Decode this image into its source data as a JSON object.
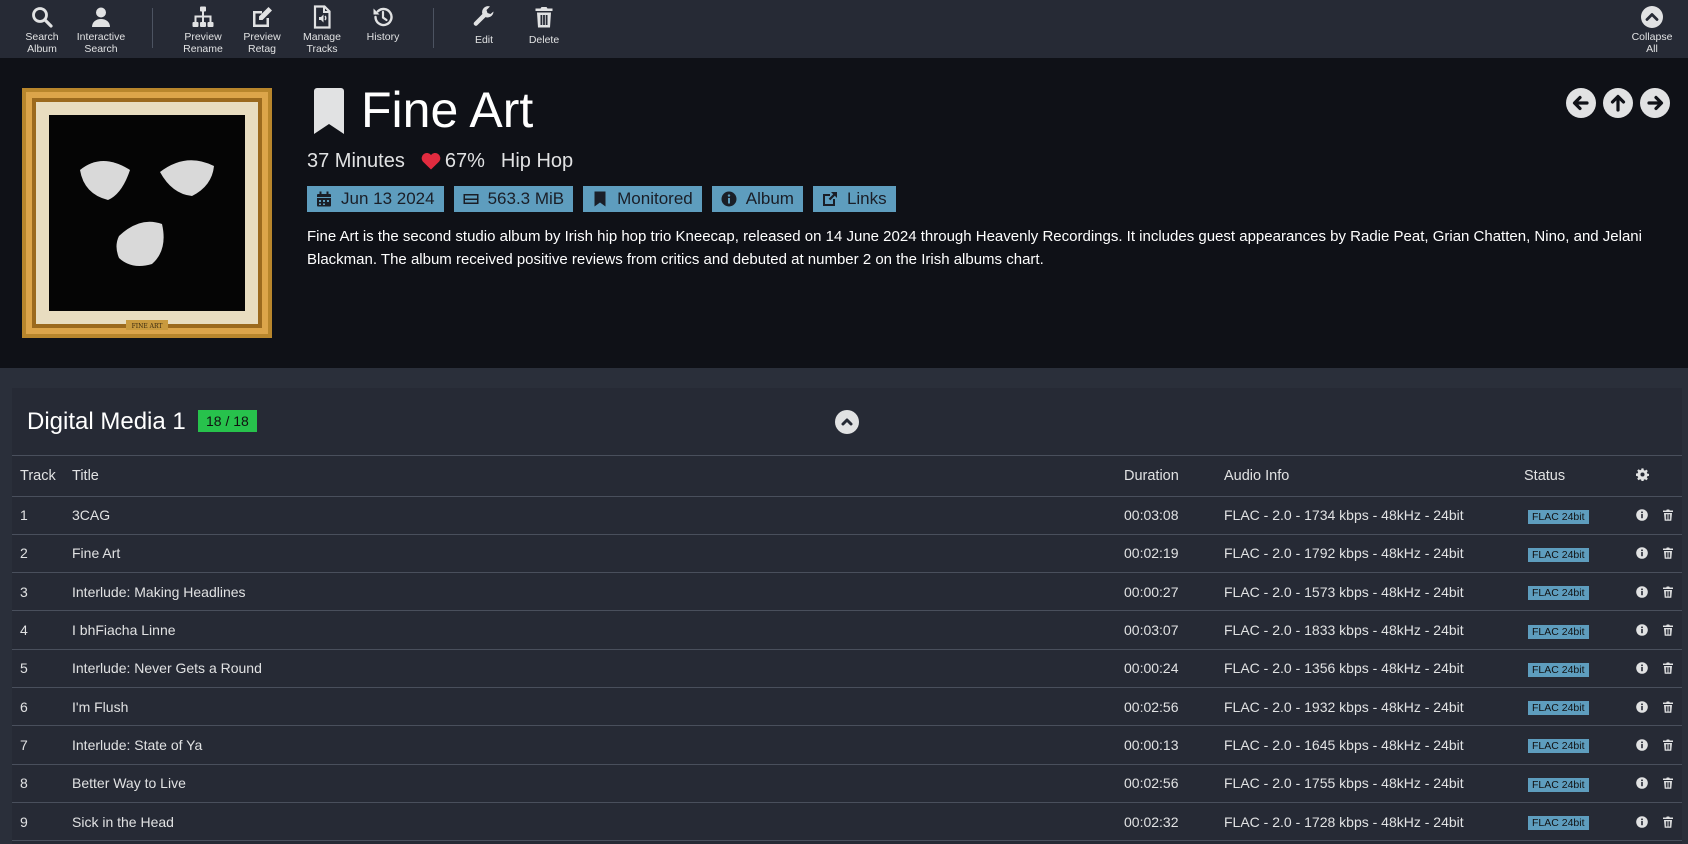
{
  "toolbar": {
    "search_album": [
      "Search",
      "Album"
    ],
    "interactive_search": [
      "Interactive",
      "Search"
    ],
    "preview_rename": [
      "Preview",
      "Rename"
    ],
    "preview_retag": [
      "Preview",
      "Retag"
    ],
    "manage_tracks": [
      "Manage",
      "Tracks"
    ],
    "history": "History",
    "edit": "Edit",
    "delete": "Delete",
    "collapse_all": [
      "Collapse",
      "All"
    ]
  },
  "album": {
    "title": "Fine Art",
    "duration": "37 Minutes",
    "rating": "67%",
    "genre": "Hip Hop",
    "release_date": "Jun 13 2024",
    "size": "563.3 MiB",
    "monitored": "Monitored",
    "type": "Album",
    "links": "Links",
    "overview": "Fine Art is the second studio album by Irish hip hop trio Kneecap, released on 14 June 2024 through Heavenly Recordings. It includes guest appearances by Radie Peat, Grian Chatten, Nino, and Jelani Blackman. The album received positive reviews from critics and debuted at number 2 on the Irish albums chart.",
    "cover_plaque_text": "FINE ART"
  },
  "medium": {
    "title": "Digital Media 1",
    "count": "18 / 18"
  },
  "columns": {
    "track": "Track",
    "title": "Title",
    "duration": "Duration",
    "audio": "Audio Info",
    "status": "Status"
  },
  "tracks": [
    {
      "num": "1",
      "title": "3CAG",
      "duration": "00:03:08",
      "audio": "FLAC - 2.0 - 1734 kbps - 48kHz - 24bit",
      "status": "FLAC 24bit"
    },
    {
      "num": "2",
      "title": "Fine Art",
      "duration": "00:02:19",
      "audio": "FLAC - 2.0 - 1792 kbps - 48kHz - 24bit",
      "status": "FLAC 24bit"
    },
    {
      "num": "3",
      "title": "Interlude: Making Headlines",
      "duration": "00:00:27",
      "audio": "FLAC - 2.0 - 1573 kbps - 48kHz - 24bit",
      "status": "FLAC 24bit"
    },
    {
      "num": "4",
      "title": "I bhFiacha Linne",
      "duration": "00:03:07",
      "audio": "FLAC - 2.0 - 1833 kbps - 48kHz - 24bit",
      "status": "FLAC 24bit"
    },
    {
      "num": "5",
      "title": "Interlude: Never Gets a Round",
      "duration": "00:00:24",
      "audio": "FLAC - 2.0 - 1356 kbps - 48kHz - 24bit",
      "status": "FLAC 24bit"
    },
    {
      "num": "6",
      "title": "I'm Flush",
      "duration": "00:02:56",
      "audio": "FLAC - 2.0 - 1932 kbps - 48kHz - 24bit",
      "status": "FLAC 24bit"
    },
    {
      "num": "7",
      "title": "Interlude: State of Ya",
      "duration": "00:00:13",
      "audio": "FLAC - 2.0 - 1645 kbps - 48kHz - 24bit",
      "status": "FLAC 24bit"
    },
    {
      "num": "8",
      "title": "Better Way to Live",
      "duration": "00:02:56",
      "audio": "FLAC - 2.0 - 1755 kbps - 48kHz - 24bit",
      "status": "FLAC 24bit"
    },
    {
      "num": "9",
      "title": "Sick in the Head",
      "duration": "00:02:32",
      "audio": "FLAC - 2.0 - 1728 kbps - 48kHz - 24bit",
      "status": "FLAC 24bit"
    }
  ],
  "colors": {
    "accent": "#5e9dbe",
    "success": "#27c24c",
    "heart": "#e12b3f",
    "toolbar_bg": "#262a35",
    "header_bg": "#0f1117"
  }
}
